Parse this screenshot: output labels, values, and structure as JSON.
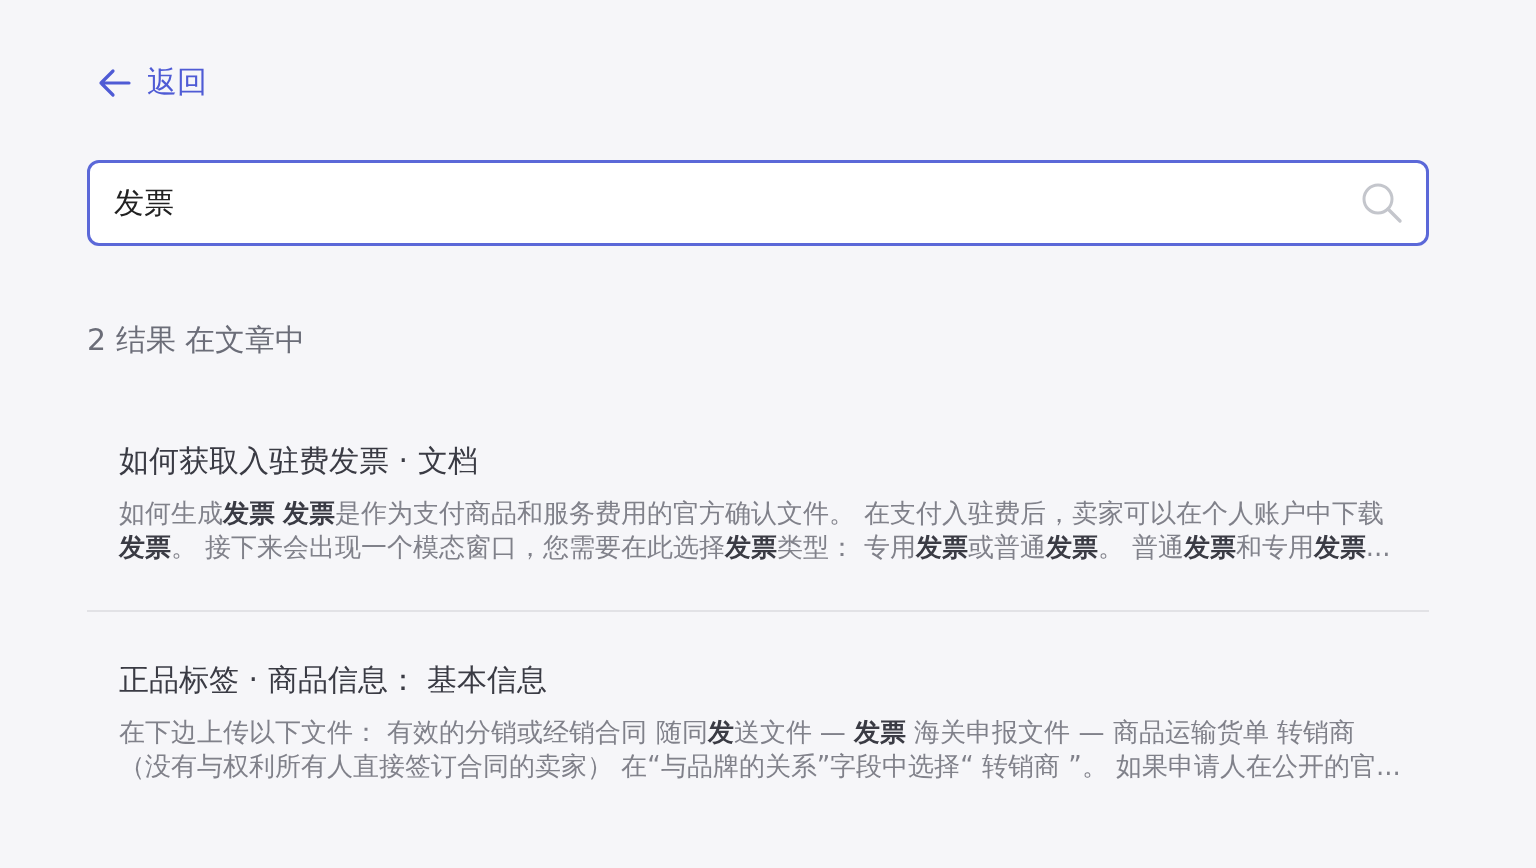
{
  "back_link": {
    "label": "返回"
  },
  "search": {
    "value": "发票"
  },
  "results_heading": "2 结果 在文章中",
  "results": [
    {
      "title": "如何获取入驻费发票 · 文档",
      "snippet": "如何生成**发票** **发票**是作为支付商品和服务费用的官方确认文件。 在支付入驻费后，卖家可以在个人账户中下载**发票**。 接下来会出现一个模态窗口，您需要在此选择**发票**类型： 专用**发票**或普通**发票**。 普通**发票**和专用**发票**..."
    },
    {
      "title": "正品标签 · 商品信息： 基本信息",
      "snippet": "在下边上传以下文件：  有效的分销或经销合同 随同**发**送文件 — **发票** 海关申报文件 — 商品运输货单 转销商（没有与权利所有人直接签订合同的卖家） 在“与品牌的关系”字段中选择“ 转销商 ”。 如果申请人在公开的官..."
    }
  ]
}
